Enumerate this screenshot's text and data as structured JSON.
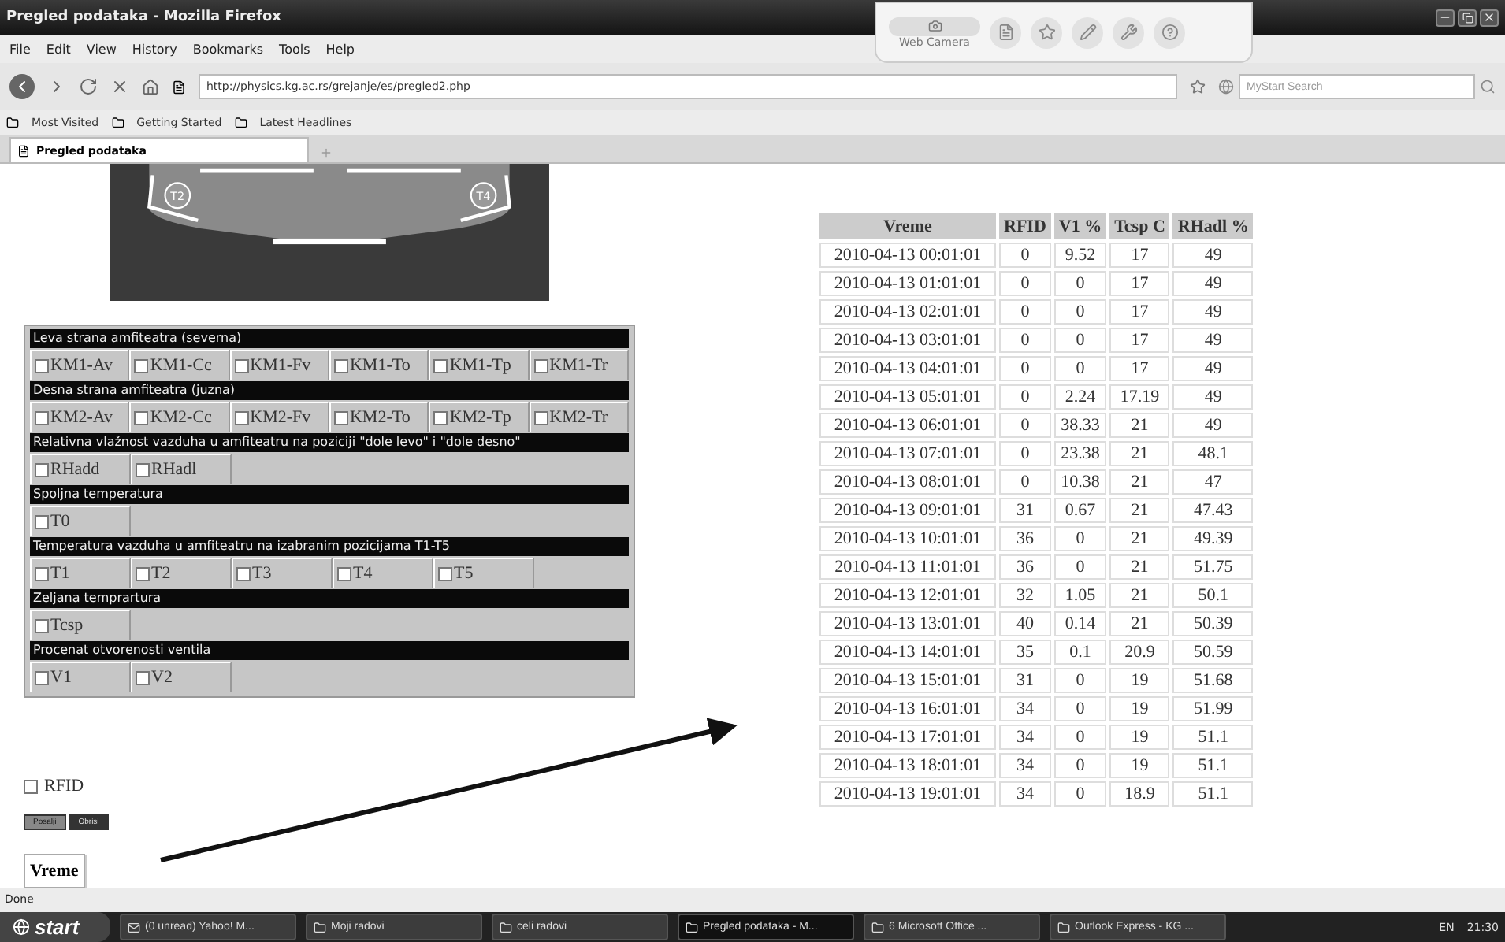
{
  "window": {
    "title": "Pregled podataka - Mozilla Firefox"
  },
  "menu": [
    "File",
    "Edit",
    "View",
    "History",
    "Bookmarks",
    "Tools",
    "Help"
  ],
  "address": {
    "value": "http://physics.kg.ac.rs/grejanje/es/pregled2.php"
  },
  "search": {
    "placeholder": "MyStart Search"
  },
  "webcam_toolbar": {
    "label": "Web Camera"
  },
  "bookmarks": [
    "Most Visited",
    "Getting Started",
    "Latest Headlines"
  ],
  "tabs": [
    {
      "label": "Pregled podataka",
      "selected": true
    }
  ],
  "floor_plan": {
    "labels": [
      "T2",
      "T4"
    ]
  },
  "sections": [
    {
      "title": "Leva strana amfiteatra (severna)",
      "options": [
        {
          "label": "KM1-Av",
          "checked": false
        },
        {
          "label": "KM1-Cc",
          "checked": false
        },
        {
          "label": "KM1-Fv",
          "checked": false
        },
        {
          "label": "KM1-To",
          "checked": false
        },
        {
          "label": "KM1-Tp",
          "checked": false
        },
        {
          "label": "KM1-Tr",
          "checked": false
        }
      ]
    },
    {
      "title": "Desna strana amfiteatra (juzna)",
      "options": [
        {
          "label": "KM2-Av",
          "checked": false
        },
        {
          "label": "KM2-Cc",
          "checked": false
        },
        {
          "label": "KM2-Fv",
          "checked": false
        },
        {
          "label": "KM2-To",
          "checked": false
        },
        {
          "label": "KM2-Tp",
          "checked": false
        },
        {
          "label": "KM2-Tr",
          "checked": false
        }
      ]
    },
    {
      "title": "Relativna vlažnost vazduha u amfiteatru na poziciji \"dole levo\" i \"dole desno\"",
      "options": [
        {
          "label": "RHadd",
          "checked": false
        },
        {
          "label": "RHadl",
          "checked": false
        }
      ]
    },
    {
      "title": "Spoljna temperatura",
      "options": [
        {
          "label": "T0",
          "checked": false
        }
      ]
    },
    {
      "title": "Temperatura vazduha u amfiteatru na izabranim pozicijama T1-T5",
      "options": [
        {
          "label": "T1",
          "checked": false
        },
        {
          "label": "T2",
          "checked": false
        },
        {
          "label": "T3",
          "checked": false
        },
        {
          "label": "T4",
          "checked": false
        },
        {
          "label": "T5",
          "checked": false
        }
      ]
    },
    {
      "title": "Zeljana temprartura",
      "options": [
        {
          "label": "Tcsp",
          "checked": false
        }
      ]
    },
    {
      "title": "Procenat otvorenosti ventila",
      "options": [
        {
          "label": "V1",
          "checked": false
        },
        {
          "label": "V2",
          "checked": false
        }
      ]
    }
  ],
  "rfid": {
    "label": "RFID",
    "checked": false
  },
  "buttons": [
    "Posalji",
    "Obrisi"
  ],
  "sort_button": "Vreme",
  "table": {
    "columns": [
      "Vreme",
      "RFID",
      "V1 %",
      "Tcsp C",
      "RHadl %"
    ],
    "rows": [
      [
        "2010-04-13 00:01:01",
        "0",
        "9.52",
        "17",
        "49"
      ],
      [
        "2010-04-13 01:01:01",
        "0",
        "0",
        "17",
        "49"
      ],
      [
        "2010-04-13 02:01:01",
        "0",
        "0",
        "17",
        "49"
      ],
      [
        "2010-04-13 03:01:01",
        "0",
        "0",
        "17",
        "49"
      ],
      [
        "2010-04-13 04:01:01",
        "0",
        "0",
        "17",
        "49"
      ],
      [
        "2010-04-13 05:01:01",
        "0",
        "2.24",
        "17.19",
        "49"
      ],
      [
        "2010-04-13 06:01:01",
        "0",
        "38.33",
        "21",
        "49"
      ],
      [
        "2010-04-13 07:01:01",
        "0",
        "23.38",
        "21",
        "48.1"
      ],
      [
        "2010-04-13 08:01:01",
        "0",
        "10.38",
        "21",
        "47"
      ],
      [
        "2010-04-13 09:01:01",
        "31",
        "0.67",
        "21",
        "47.43"
      ],
      [
        "2010-04-13 10:01:01",
        "36",
        "0",
        "21",
        "49.39"
      ],
      [
        "2010-04-13 11:01:01",
        "36",
        "0",
        "21",
        "51.75"
      ],
      [
        "2010-04-13 12:01:01",
        "32",
        "1.05",
        "21",
        "50.1"
      ],
      [
        "2010-04-13 13:01:01",
        "40",
        "0.14",
        "21",
        "50.39"
      ],
      [
        "2010-04-13 14:01:01",
        "35",
        "0.1",
        "20.9",
        "50.59"
      ],
      [
        "2010-04-13 15:01:01",
        "31",
        "0",
        "19",
        "51.68"
      ],
      [
        "2010-04-13 16:01:01",
        "34",
        "0",
        "19",
        "51.99"
      ],
      [
        "2010-04-13 17:01:01",
        "34",
        "0",
        "19",
        "51.1"
      ],
      [
        "2010-04-13 18:01:01",
        "34",
        "0",
        "19",
        "51.1"
      ],
      [
        "2010-04-13 19:01:01",
        "34",
        "0",
        "18.9",
        "51.1"
      ]
    ]
  },
  "status_bar": {
    "text": "Done"
  },
  "taskbar": {
    "start": "start",
    "tasks": [
      {
        "label": "(0 unread) Yahoo! M...",
        "active": false
      },
      {
        "label": "Moji radovi",
        "active": false
      },
      {
        "label": "celi radovi",
        "active": false
      },
      {
        "label": "Pregled podataka - M...",
        "active": true
      },
      {
        "label": "6 Microsoft Office ...",
        "active": false
      },
      {
        "label": "Outlook Express - KG ...",
        "active": false
      }
    ],
    "language": "EN",
    "clock": "21:30"
  }
}
